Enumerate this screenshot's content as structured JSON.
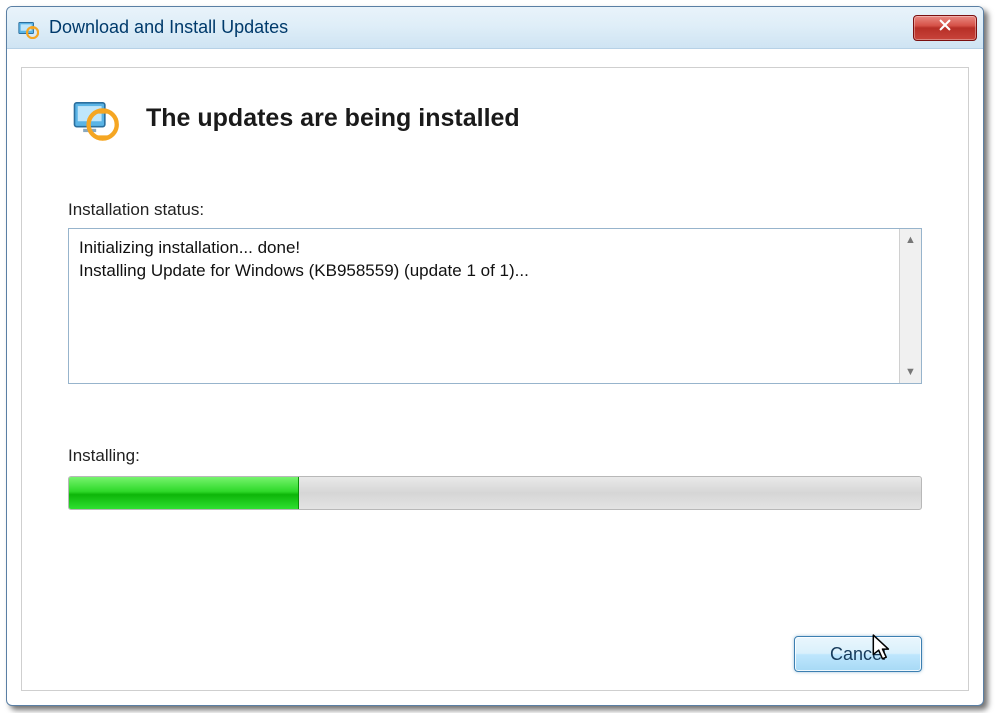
{
  "titlebar": {
    "title": "Download and Install Updates"
  },
  "header": {
    "heading": "The updates are being installed"
  },
  "status": {
    "label": "Installation status:",
    "log": "Initializing installation... done!\nInstalling Update for Windows (KB958559) (update 1 of 1)... "
  },
  "progress": {
    "label": "Installing:",
    "percent": 27
  },
  "buttons": {
    "cancel": "Cancel"
  },
  "colors": {
    "progress_green": "#2fd92a",
    "aero_border": "#97b4cc"
  }
}
